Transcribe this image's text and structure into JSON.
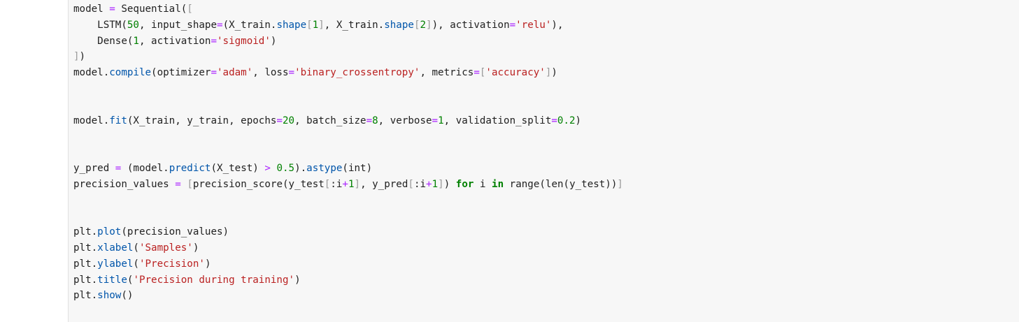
{
  "code_lines": [
    {
      "tokens": [
        {
          "t": "model ",
          "c": "plain"
        },
        {
          "t": "=",
          "c": "op"
        },
        {
          "t": " Sequential(",
          "c": "plain"
        },
        {
          "t": "[",
          "c": "brk"
        }
      ]
    },
    {
      "tokens": [
        {
          "t": "    LSTM(",
          "c": "plain"
        },
        {
          "t": "50",
          "c": "num"
        },
        {
          "t": ", input_shape",
          "c": "plain"
        },
        {
          "t": "=",
          "c": "op"
        },
        {
          "t": "(X_train.",
          "c": "plain"
        },
        {
          "t": "shape",
          "c": "attr"
        },
        {
          "t": "[",
          "c": "brk"
        },
        {
          "t": "1",
          "c": "num"
        },
        {
          "t": "]",
          "c": "brk"
        },
        {
          "t": ", X_train.",
          "c": "plain"
        },
        {
          "t": "shape",
          "c": "attr"
        },
        {
          "t": "[",
          "c": "brk"
        },
        {
          "t": "2",
          "c": "num"
        },
        {
          "t": "]",
          "c": "brk"
        },
        {
          "t": "), activation",
          "c": "plain"
        },
        {
          "t": "=",
          "c": "op"
        },
        {
          "t": "'relu'",
          "c": "str"
        },
        {
          "t": "),",
          "c": "plain"
        }
      ]
    },
    {
      "tokens": [
        {
          "t": "    Dense(",
          "c": "plain"
        },
        {
          "t": "1",
          "c": "num"
        },
        {
          "t": ", activation",
          "c": "plain"
        },
        {
          "t": "=",
          "c": "op"
        },
        {
          "t": "'sigmoid'",
          "c": "str"
        },
        {
          "t": ")",
          "c": "plain"
        }
      ]
    },
    {
      "tokens": [
        {
          "t": "]",
          "c": "brk"
        },
        {
          "t": ")",
          "c": "plain"
        }
      ]
    },
    {
      "tokens": [
        {
          "t": "model.",
          "c": "plain"
        },
        {
          "t": "compile",
          "c": "attr"
        },
        {
          "t": "(optimizer",
          "c": "plain"
        },
        {
          "t": "=",
          "c": "op"
        },
        {
          "t": "'adam'",
          "c": "str"
        },
        {
          "t": ", loss",
          "c": "plain"
        },
        {
          "t": "=",
          "c": "op"
        },
        {
          "t": "'binary_crossentropy'",
          "c": "str"
        },
        {
          "t": ", metrics",
          "c": "plain"
        },
        {
          "t": "=",
          "c": "op"
        },
        {
          "t": "[",
          "c": "brk"
        },
        {
          "t": "'accuracy'",
          "c": "str"
        },
        {
          "t": "]",
          "c": "brk"
        },
        {
          "t": ")",
          "c": "plain"
        }
      ]
    },
    {
      "tokens": []
    },
    {
      "tokens": []
    },
    {
      "tokens": [
        {
          "t": "model.",
          "c": "plain"
        },
        {
          "t": "fit",
          "c": "attr"
        },
        {
          "t": "(X_train, y_train, epochs",
          "c": "plain"
        },
        {
          "t": "=",
          "c": "op"
        },
        {
          "t": "20",
          "c": "num"
        },
        {
          "t": ", batch_size",
          "c": "plain"
        },
        {
          "t": "=",
          "c": "op"
        },
        {
          "t": "8",
          "c": "num"
        },
        {
          "t": ", verbose",
          "c": "plain"
        },
        {
          "t": "=",
          "c": "op"
        },
        {
          "t": "1",
          "c": "num"
        },
        {
          "t": ", validation_split",
          "c": "plain"
        },
        {
          "t": "=",
          "c": "op"
        },
        {
          "t": "0.2",
          "c": "num"
        },
        {
          "t": ")",
          "c": "plain"
        }
      ]
    },
    {
      "tokens": []
    },
    {
      "tokens": []
    },
    {
      "tokens": [
        {
          "t": "y_pred ",
          "c": "plain"
        },
        {
          "t": "=",
          "c": "op"
        },
        {
          "t": " (model.",
          "c": "plain"
        },
        {
          "t": "predict",
          "c": "attr"
        },
        {
          "t": "(X_test) ",
          "c": "plain"
        },
        {
          "t": ">",
          "c": "op"
        },
        {
          "t": " ",
          "c": "plain"
        },
        {
          "t": "0.5",
          "c": "num"
        },
        {
          "t": ").",
          "c": "plain"
        },
        {
          "t": "astype",
          "c": "attr"
        },
        {
          "t": "(int)",
          "c": "plain"
        }
      ]
    },
    {
      "tokens": [
        {
          "t": "precision_values ",
          "c": "plain"
        },
        {
          "t": "=",
          "c": "op"
        },
        {
          "t": " ",
          "c": "plain"
        },
        {
          "t": "[",
          "c": "brk"
        },
        {
          "t": "precision_score(y_test",
          "c": "plain"
        },
        {
          "t": "[",
          "c": "brk"
        },
        {
          "t": ":i",
          "c": "plain"
        },
        {
          "t": "+",
          "c": "op"
        },
        {
          "t": "1",
          "c": "num"
        },
        {
          "t": "]",
          "c": "brk"
        },
        {
          "t": ", y_pred",
          "c": "plain"
        },
        {
          "t": "[",
          "c": "brk"
        },
        {
          "t": ":i",
          "c": "plain"
        },
        {
          "t": "+",
          "c": "op"
        },
        {
          "t": "1",
          "c": "num"
        },
        {
          "t": "]",
          "c": "brk"
        },
        {
          "t": ") ",
          "c": "plain"
        },
        {
          "t": "for",
          "c": "kw"
        },
        {
          "t": " i ",
          "c": "plain"
        },
        {
          "t": "in",
          "c": "kw"
        },
        {
          "t": " range(len(y_test))",
          "c": "plain"
        },
        {
          "t": "]",
          "c": "brk"
        }
      ]
    },
    {
      "tokens": []
    },
    {
      "tokens": []
    },
    {
      "tokens": [
        {
          "t": "plt.",
          "c": "plain"
        },
        {
          "t": "plot",
          "c": "attr"
        },
        {
          "t": "(precision_values)",
          "c": "plain"
        }
      ]
    },
    {
      "tokens": [
        {
          "t": "plt.",
          "c": "plain"
        },
        {
          "t": "xlabel",
          "c": "attr"
        },
        {
          "t": "(",
          "c": "plain"
        },
        {
          "t": "'Samples'",
          "c": "str"
        },
        {
          "t": ")",
          "c": "plain"
        }
      ]
    },
    {
      "tokens": [
        {
          "t": "plt.",
          "c": "plain"
        },
        {
          "t": "ylabel",
          "c": "attr"
        },
        {
          "t": "(",
          "c": "plain"
        },
        {
          "t": "'Precision'",
          "c": "str"
        },
        {
          "t": ")",
          "c": "plain"
        }
      ]
    },
    {
      "tokens": [
        {
          "t": "plt.",
          "c": "plain"
        },
        {
          "t": "title",
          "c": "attr"
        },
        {
          "t": "(",
          "c": "plain"
        },
        {
          "t": "'Precision during training'",
          "c": "str"
        },
        {
          "t": ")",
          "c": "plain"
        }
      ]
    },
    {
      "tokens": [
        {
          "t": "plt.",
          "c": "plain"
        },
        {
          "t": "show",
          "c": "attr"
        },
        {
          "t": "()",
          "c": "plain"
        }
      ]
    }
  ],
  "colors": {
    "cell_background": "#f7f7f7",
    "text": "#212121",
    "keyword": "#008000",
    "number": "#008000",
    "string": "#ba2121",
    "operator": "#aa22ff",
    "attribute": "#0055aa",
    "bracket": "#999999"
  }
}
